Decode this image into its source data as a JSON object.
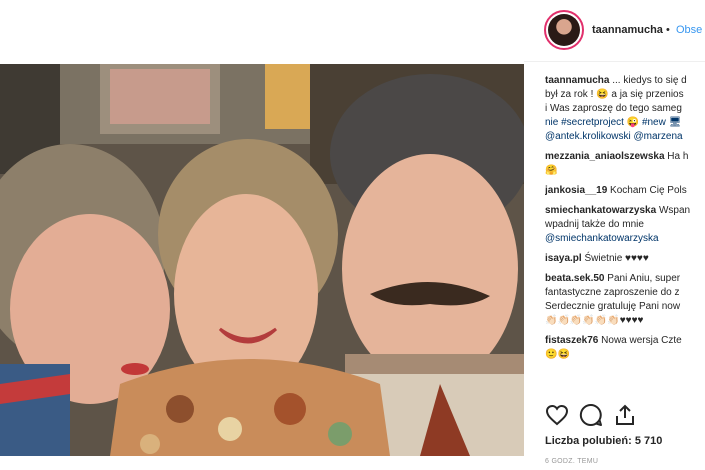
{
  "header": {
    "username": "taannamucha",
    "separator": "•",
    "follow_label": "Obse"
  },
  "comments": [
    {
      "user": "taannamucha",
      "lines": [
        "... kiedys to się d",
        "był za rok ! 😆 a ja się przenios",
        "i Was zaproszę do tego sameg",
        "nie #secretproject 😜 #new 🖥"
      ],
      "mentions": "@antek.krolikowski @marzena"
    },
    {
      "user": "mezzania_aniaolszewska",
      "text": "Ha h",
      "extra": "🤗"
    },
    {
      "user": "jankosia__19",
      "text": "Kocham Cię Pols"
    },
    {
      "user": "smiechankatowarzyska",
      "text": "Wspan",
      "line2": "wpadnij także do mnie",
      "mention": "@smiechankatowarzyska"
    },
    {
      "user": "isaya.pl",
      "text": "Świetnie ♥♥♥♥"
    },
    {
      "user": "beata.sek.50",
      "text": "Pani Aniu, super",
      "line2": "fantastyczne zaproszenie do z",
      "line3": "Serdecznie gratuluję Pani now",
      "line4": "👏🏻👏🏻👏🏻👏🏻👏🏻👏🏻♥♥♥♥"
    },
    {
      "user": "fistaszek76",
      "text": "Nowa wersja Czte",
      "extra": "🙂😆"
    }
  ],
  "actions": {
    "like_icon": "heart-icon",
    "comment_icon": "comment-icon",
    "share_icon": "share-icon"
  },
  "likes": {
    "label": "Liczba polubień:",
    "count": "5 710"
  },
  "time": "6 GODZ. TEMU",
  "colors": {
    "link": "#003569",
    "follow": "#3897f0",
    "muted": "#999999"
  }
}
